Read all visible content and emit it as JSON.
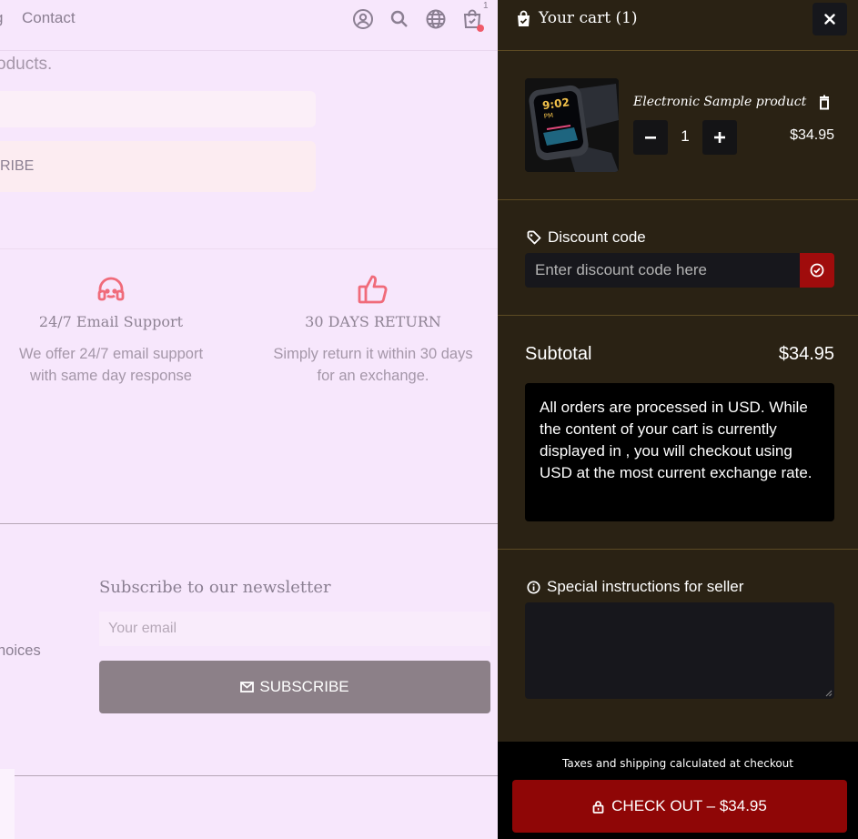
{
  "header": {
    "nav_partial": "g",
    "contact": "Contact",
    "icons": [
      "account-icon",
      "search-icon",
      "globe-icon",
      "cart-icon"
    ],
    "cart_count": "1"
  },
  "page": {
    "partial_text": "oducts.",
    "subscribe_partial": "RIBE",
    "features": [
      {
        "icon": "support-headset-icon",
        "title": "24/7 Email Support",
        "desc_line1": "We offer 24/7 email support",
        "desc_line2": "with same day response"
      },
      {
        "icon": "thumbs-up-icon",
        "title": "30 DAYS RETURN",
        "desc_line1": "Simply return it within 30 days",
        "desc_line2": "for an exchange."
      }
    ],
    "choices_partial": "hoices",
    "newsletter": {
      "title": "Subscribe to our newsletter",
      "placeholder": "Your email",
      "button": "SUBSCRIBE"
    },
    "accent_color": "#f06b7a"
  },
  "cart": {
    "title": "Your cart (1)",
    "item": {
      "name": "Electronic Sample product",
      "quantity": "1",
      "price": "$34.95",
      "image_time": "9:02",
      "image_ampm": "PM"
    },
    "discount": {
      "label": "Discount code",
      "placeholder": "Enter discount code here"
    },
    "subtotal_label": "Subtotal",
    "subtotal_value": "$34.95",
    "notice": "All orders are processed in USD. While the content of your cart is currently displayed in , you will checkout using USD at the most current exchange rate.",
    "instructions_label": "Special instructions for seller",
    "tax_note": "Taxes and shipping calculated at checkout",
    "checkout": "CHECK OUT – $34.95",
    "colors": {
      "background": "#2a2214",
      "checkout": "#8f0606",
      "discount_apply": "#a00c0c"
    }
  }
}
